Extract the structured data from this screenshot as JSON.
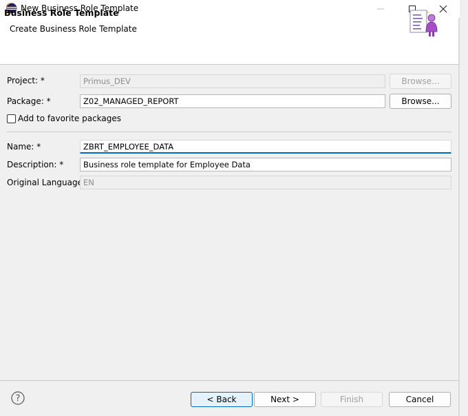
{
  "window": {
    "title": "New Business Role Template",
    "icons": [
      "eclipse-icon",
      "minimize-icon",
      "maximize-icon",
      "close-icon"
    ]
  },
  "banner": {
    "title": "Business Role Template",
    "subtitle": "Create Business Role Template",
    "image": "business-role-template-icon"
  },
  "form": {
    "project": {
      "label": "Project: *",
      "value": "Primus_DEV",
      "browse": "Browse..."
    },
    "package": {
      "label": "Package: *",
      "value": "Z02_MANAGED_REPORT",
      "browse": "Browse..."
    },
    "favorite": {
      "label": "Add to favorite packages",
      "checked": false
    },
    "name": {
      "label": "Name: *",
      "value": "ZBRT_EMPLOYEE_DATA"
    },
    "description": {
      "label": "Description: *",
      "value": "Business role template for Employee Data"
    },
    "language": {
      "label": "Original Language:",
      "value": "EN"
    }
  },
  "footer": {
    "help_icon": "help-icon",
    "back": "< Back",
    "next": "Next >",
    "finish": "Finish",
    "cancel": "Cancel"
  },
  "colors": {
    "accent": "#0067c0",
    "background": "#f0f0f0"
  }
}
